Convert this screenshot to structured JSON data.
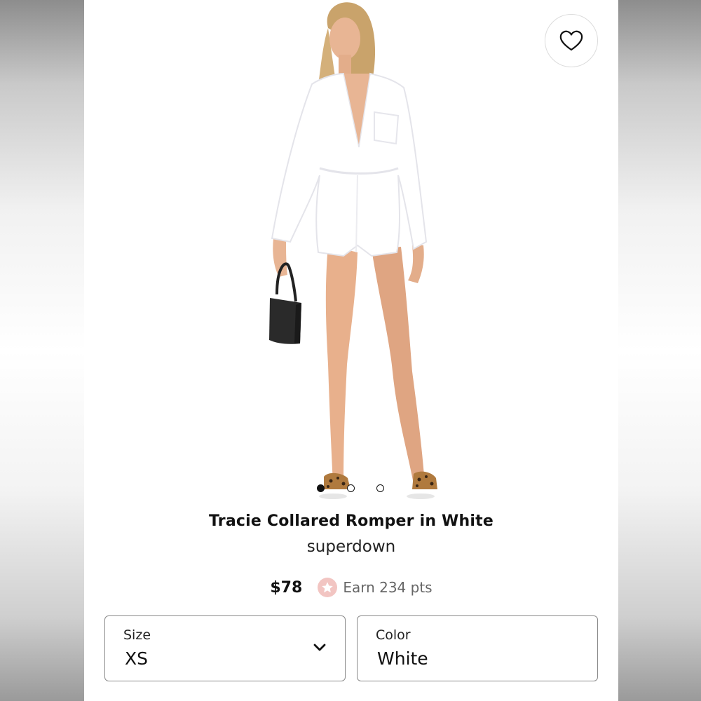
{
  "product": {
    "title": "Tracie Collared Romper in White",
    "brand": "superdown",
    "price": "$78",
    "points_text": "Earn 234 pts"
  },
  "gallery": {
    "image_count": 3,
    "active_index": 0
  },
  "size_select": {
    "label": "Size",
    "value": "XS"
  },
  "color_select": {
    "label": "Color",
    "value": "White"
  },
  "icons": {
    "favorite": "heart-icon",
    "points": "star-icon",
    "dropdown": "chevron-down-icon"
  },
  "colors": {
    "text": "#111111",
    "points_badge": "#f2c5c2",
    "border": "#8a8a8a"
  }
}
